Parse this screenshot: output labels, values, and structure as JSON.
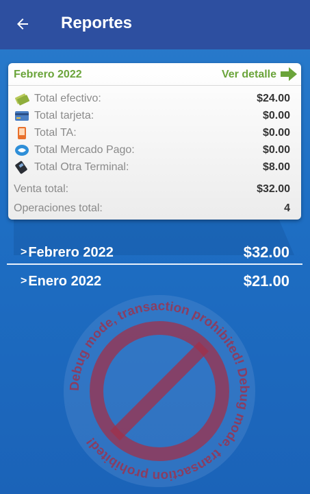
{
  "appbar": {
    "title": "Reportes",
    "back_icon": "arrow-left-icon"
  },
  "card": {
    "month": "Febrero 2022",
    "detail_label": "Ver detalle",
    "rows": [
      {
        "icon": "cash-icon",
        "label": "Total efectivo:",
        "value": "$24.00"
      },
      {
        "icon": "credit-card-icon",
        "label": "Total tarjeta:",
        "value": "$0.00"
      },
      {
        "icon": "phone-icon",
        "label": "Total TA:",
        "value": "$0.00"
      },
      {
        "icon": "mercado-pago-icon",
        "label": "Total Mercado Pago:",
        "value": "$0.00"
      },
      {
        "icon": "terminal-icon",
        "label": "Total Otra Terminal:",
        "value": "$8.00"
      }
    ],
    "total_sales_label": "Venta total:",
    "total_sales_value": "$32.00",
    "operations_label": "Operaciones total:",
    "operations_value": "4"
  },
  "months": [
    {
      "chevron": ">",
      "label": "Febrero 2022",
      "amount": "$32.00"
    },
    {
      "chevron": ">",
      "label": "Enero 2022",
      "amount": "$21.00"
    }
  ],
  "debug_watermark": "Debug mode, transaction prohibited! Debug mode, transaction prohibited!",
  "colors": {
    "appbar": "#2d4fa0",
    "background": "#1e6fc4",
    "accent_green": "#6aa43a",
    "watermark": "#a0304a"
  }
}
